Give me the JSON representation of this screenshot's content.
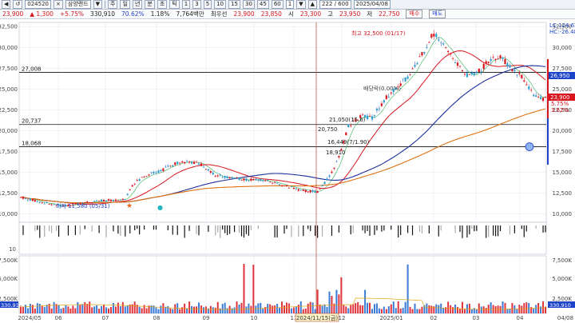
{
  "toolbar": {
    "buttons": [
      "◀",
      "↺",
      "×",
      "▼",
      "주",
      "일",
      "년",
      "분",
      "초",
      "틱",
      "1",
      "3",
      "5",
      "10",
      "15",
      "30",
      "45",
      "60",
      "1",
      "▼",
      "▲"
    ],
    "stock_code": "024520",
    "stock_name": "삼양랜드",
    "period_display": "222 / 600",
    "date": "2025/04/08"
  },
  "info": {
    "price": "23,900",
    "change": "▲ 1,300",
    "change_pct": "+5.75%",
    "volume": "330,910",
    "volume_ratio": "70.62%",
    "turnover": "1.18%",
    "trade_value": "7,764백만",
    "priority_ask": "23,900",
    "priority_bid": "23,850",
    "open": "23,300",
    "high": "23,950",
    "low": "22,750",
    "labels": {
      "priority": "최우선",
      "open": "시",
      "high": "고",
      "low": "저"
    },
    "buy_label": "매수",
    "sell_label": "매도"
  },
  "chart_data": {
    "type": "candlestick",
    "price_axis": {
      "min": 10000,
      "max": 32500,
      "ticks": [
        "10,000",
        "12,500",
        "15,000",
        "17,500",
        "20,000",
        "22,500",
        "25,000",
        "27,500",
        "30,000",
        "32,500"
      ]
    },
    "x_ticks": [
      "2024/05",
      "06",
      "07",
      "08",
      "09",
      "10",
      "11",
      "12",
      "2025/01",
      "02",
      "03",
      "04",
      "04/08"
    ],
    "horizontal_lines": [
      {
        "label": "27,008",
        "value": 27008
      },
      {
        "label": "20,737",
        "value": 20737
      },
      {
        "label": "18,068",
        "value": 18068
      }
    ],
    "right_labels": {
      "lc": "LC:124.62",
      "hc": "HC:-26.48",
      "price_tag": "26,950",
      "last_tag": "23,900",
      "pct1": "5.75%",
      "pct2": "3.62%"
    },
    "annotations": {
      "high": "최고 32,500 (01/17)",
      "low": "최저 11,580 (05/31)",
      "flat": "배당락(0.00%)",
      "a1": "21,050(15.6)",
      "a2": "20,750",
      "a3": "16,449(7/1.90)",
      "a4": "18,910"
    },
    "current_date_label": "2024/11/15(금)",
    "volume_axis": [
      "7,500K",
      "5,000K",
      "2,500K"
    ],
    "volume_last": "330,910",
    "indicator_axis": [
      "10"
    ]
  }
}
